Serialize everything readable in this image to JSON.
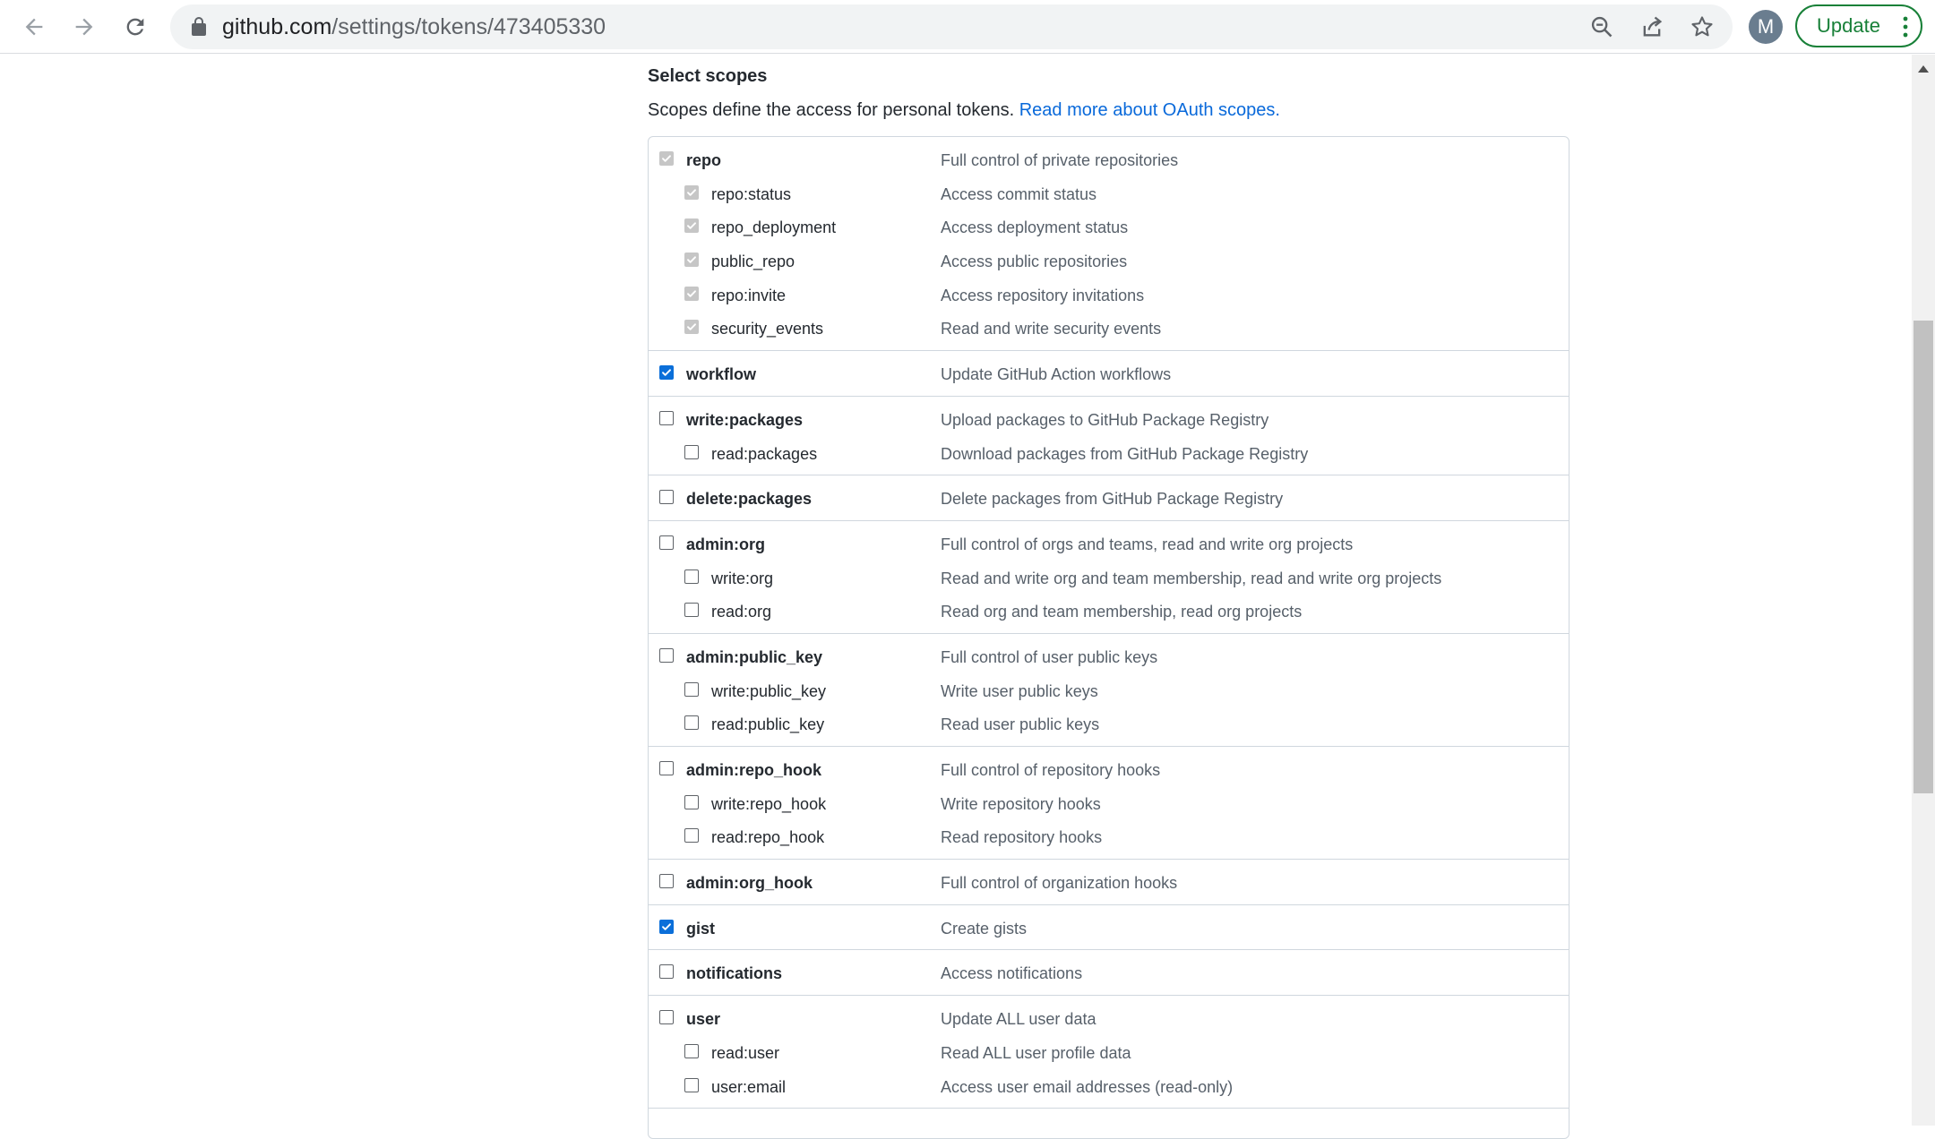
{
  "browser": {
    "url_host": "github.com",
    "url_path": "/settings/tokens/473405330",
    "avatar_letter": "M",
    "update_label": "Update",
    "colors": {
      "update_green": "#188038",
      "avatar": "#6a7d8f"
    }
  },
  "page": {
    "title": "Select scopes",
    "description": "Scopes define the access for personal tokens.",
    "link_text": "Read more about OAuth scopes.",
    "colors": {
      "link": "#0969da",
      "checkbox_checked": "#0b6fd9"
    }
  },
  "groups": [
    {
      "items": [
        {
          "name": "repo",
          "desc": "Full control of private repositories",
          "level": 0,
          "state": "checked-disabled"
        },
        {
          "name": "repo:status",
          "desc": "Access commit status",
          "level": 1,
          "state": "checked-disabled"
        },
        {
          "name": "repo_deployment",
          "desc": "Access deployment status",
          "level": 1,
          "state": "checked-disabled"
        },
        {
          "name": "public_repo",
          "desc": "Access public repositories",
          "level": 1,
          "state": "checked-disabled"
        },
        {
          "name": "repo:invite",
          "desc": "Access repository invitations",
          "level": 1,
          "state": "checked-disabled"
        },
        {
          "name": "security_events",
          "desc": "Read and write security events",
          "level": 1,
          "state": "checked-disabled"
        }
      ]
    },
    {
      "items": [
        {
          "name": "workflow",
          "desc": "Update GitHub Action workflows",
          "level": 0,
          "state": "checked"
        }
      ]
    },
    {
      "items": [
        {
          "name": "write:packages",
          "desc": "Upload packages to GitHub Package Registry",
          "level": 0,
          "state": "unchecked"
        },
        {
          "name": "read:packages",
          "desc": "Download packages from GitHub Package Registry",
          "level": 1,
          "state": "unchecked"
        }
      ]
    },
    {
      "items": [
        {
          "name": "delete:packages",
          "desc": "Delete packages from GitHub Package Registry",
          "level": 0,
          "state": "unchecked"
        }
      ]
    },
    {
      "items": [
        {
          "name": "admin:org",
          "desc": "Full control of orgs and teams, read and write org projects",
          "level": 0,
          "state": "unchecked"
        },
        {
          "name": "write:org",
          "desc": "Read and write org and team membership, read and write org projects",
          "level": 1,
          "state": "unchecked"
        },
        {
          "name": "read:org",
          "desc": "Read org and team membership, read org projects",
          "level": 1,
          "state": "unchecked"
        }
      ]
    },
    {
      "items": [
        {
          "name": "admin:public_key",
          "desc": "Full control of user public keys",
          "level": 0,
          "state": "unchecked"
        },
        {
          "name": "write:public_key",
          "desc": "Write user public keys",
          "level": 1,
          "state": "unchecked"
        },
        {
          "name": "read:public_key",
          "desc": "Read user public keys",
          "level": 1,
          "state": "unchecked"
        }
      ]
    },
    {
      "items": [
        {
          "name": "admin:repo_hook",
          "desc": "Full control of repository hooks",
          "level": 0,
          "state": "unchecked"
        },
        {
          "name": "write:repo_hook",
          "desc": "Write repository hooks",
          "level": 1,
          "state": "unchecked"
        },
        {
          "name": "read:repo_hook",
          "desc": "Read repository hooks",
          "level": 1,
          "state": "unchecked"
        }
      ]
    },
    {
      "items": [
        {
          "name": "admin:org_hook",
          "desc": "Full control of organization hooks",
          "level": 0,
          "state": "unchecked"
        }
      ]
    },
    {
      "items": [
        {
          "name": "gist",
          "desc": "Create gists",
          "level": 0,
          "state": "checked"
        }
      ]
    },
    {
      "items": [
        {
          "name": "notifications",
          "desc": "Access notifications",
          "level": 0,
          "state": "unchecked"
        }
      ]
    },
    {
      "items": [
        {
          "name": "user",
          "desc": "Update ALL user data",
          "level": 0,
          "state": "unchecked"
        },
        {
          "name": "read:user",
          "desc": "Read ALL user profile data",
          "level": 1,
          "state": "unchecked"
        },
        {
          "name": "user:email",
          "desc": "Access user email addresses (read-only)",
          "level": 1,
          "state": "unchecked"
        }
      ]
    }
  ]
}
